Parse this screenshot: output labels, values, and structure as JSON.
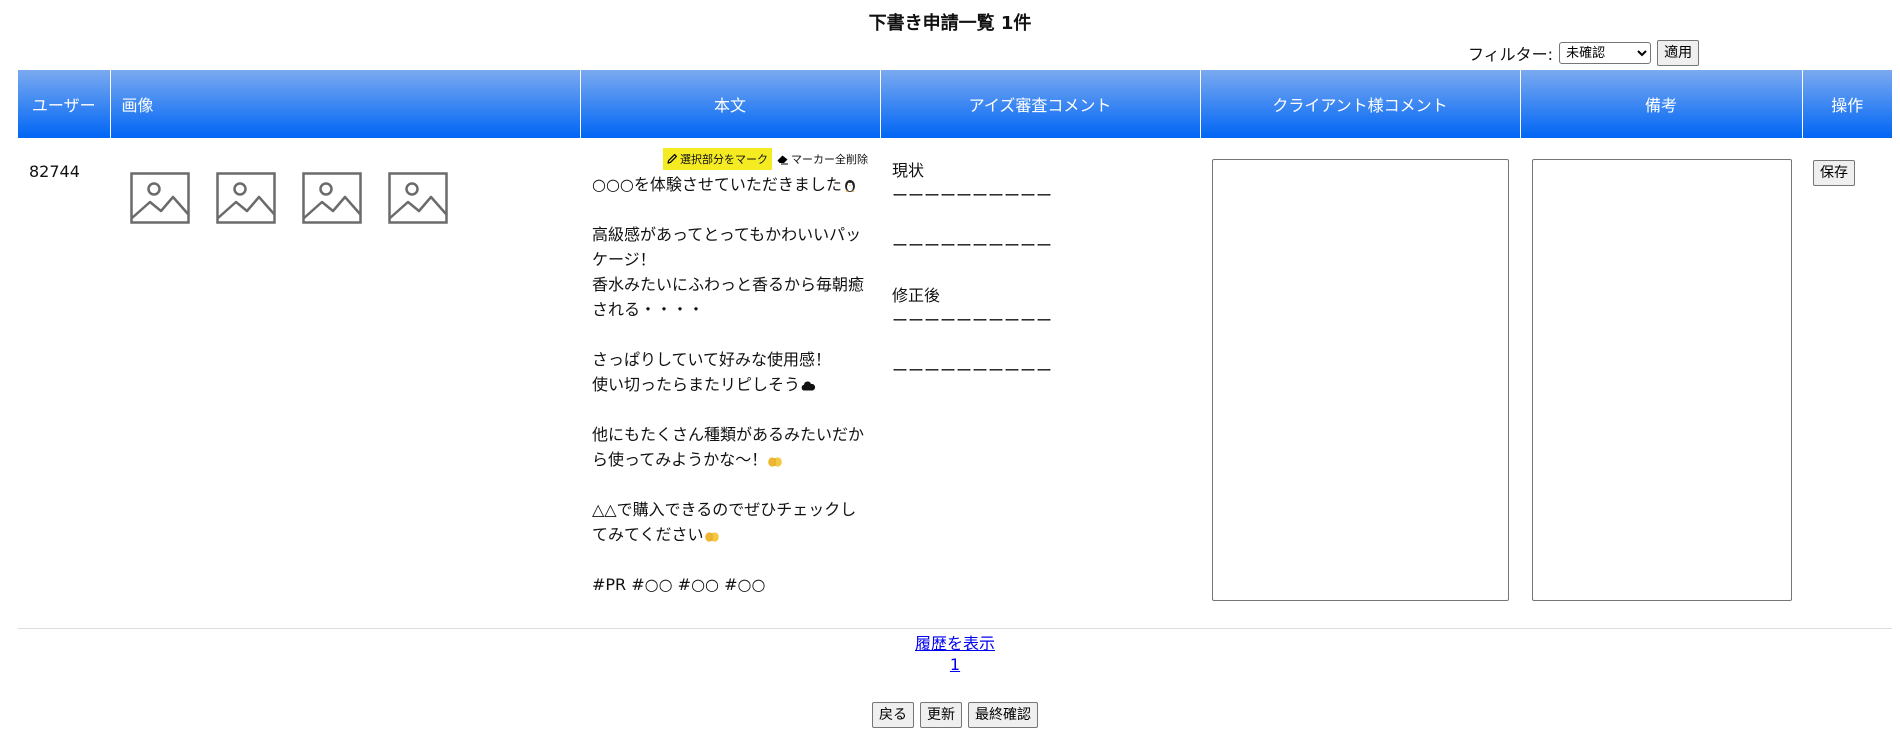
{
  "page": {
    "title": "下書き申請一覧 1件"
  },
  "filter": {
    "label": "フィルター:",
    "selected": "未確認",
    "apply_label": "適用"
  },
  "table": {
    "headers": {
      "user": "ユーザー",
      "image": "画像",
      "body": "本文",
      "review_comment": "アイズ審査コメント",
      "client_comment": "クライアント様コメント",
      "notes": "備考",
      "ops": "操作"
    },
    "row": {
      "user_id": "82744",
      "images": [
        "image-placeholder-icon",
        "image-placeholder-icon",
        "image-placeholder-icon",
        "image-placeholder-icon"
      ],
      "marker": {
        "mark_label": "選択部分をマーク",
        "clear_label": "マーカー全削除"
      },
      "body_lines": {
        "l1": "○○○を体験させていただきました",
        "l2": "高級感があってとってもかわいいパッ",
        "l3": "ケージ！",
        "l4": "香水みたいにふわっと香るから毎朝癒",
        "l5": "される・・・・",
        "l6": "さっぱりしていて好みな使用感！",
        "l7": "使い切ったらまたリピしそう",
        "l8": "他にもたくさん種類があるみたいだか",
        "l9": "ら使ってみようかな～！",
        "l10": "△△で購入できるのでぜひチェックし",
        "l11": "てみてください",
        "l12": "#PR #○○ #○○ #○○"
      },
      "review": {
        "current_label": "現状",
        "divider": "ーーーーーーーーーー",
        "revised_label": "修正後"
      },
      "save_label": "保存"
    }
  },
  "footer": {
    "history_link": "履歴を表示",
    "page_number": "1",
    "back_label": "戻る",
    "refresh_label": "更新",
    "final_check_label": "最終確認"
  },
  "colors": {
    "header_top": "#7aaaf0",
    "header_bottom": "#0066f5",
    "marker_yellow": "#f5eb23",
    "link": "#0000ee"
  }
}
